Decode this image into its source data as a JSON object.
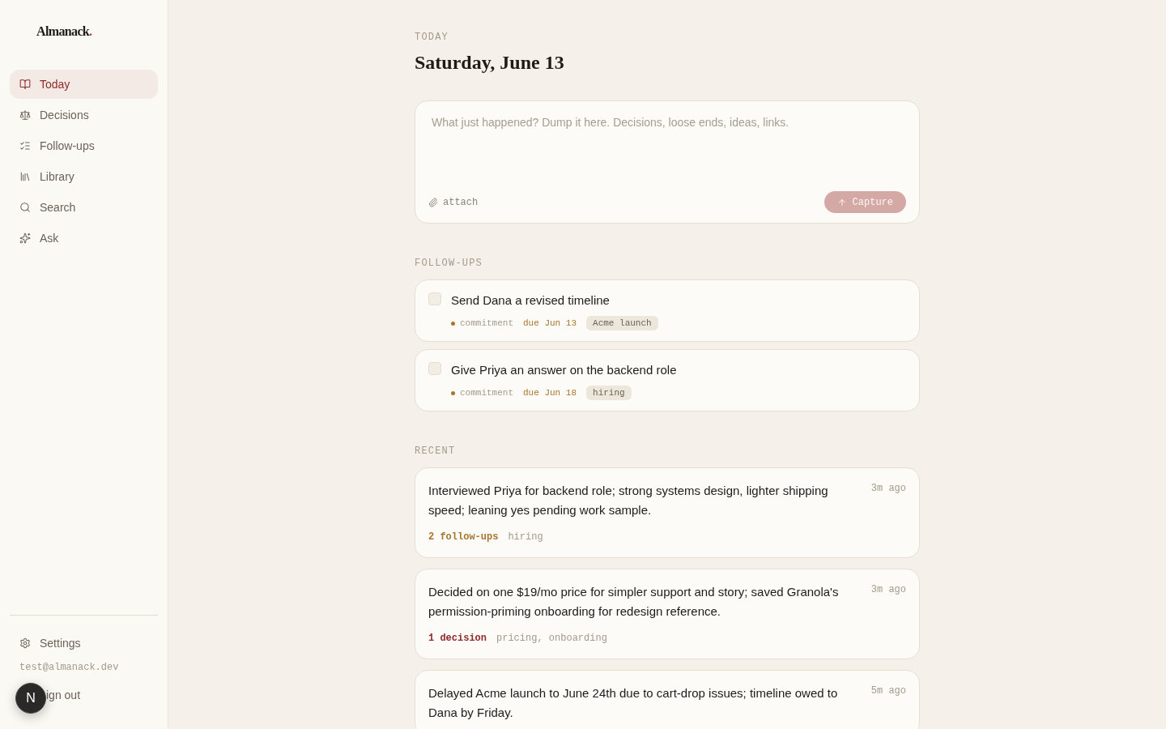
{
  "sidebar": {
    "logo": "Almanack.",
    "nav": [
      {
        "label": "Today",
        "selected": true
      },
      {
        "label": "Decisions",
        "selected": false
      },
      {
        "label": "Follow-ups",
        "selected": false
      },
      {
        "label": "Library",
        "selected": false
      },
      {
        "label": "Search",
        "selected": false
      },
      {
        "label": "Ask",
        "selected": false
      }
    ],
    "settings": "Settings",
    "email": "test@almanack.dev",
    "sign_out": "ign out"
  },
  "dev_badge": "N",
  "header": {
    "eyebrow": "TODAY",
    "title": "Saturday, June 13"
  },
  "capture": {
    "placeholder": "What just happened? Dump it here. Decisions, loose ends, ideas, links.",
    "attach": "attach",
    "submit": {
      "label": "Capture",
      "disabled": true
    }
  },
  "follow_ups": {
    "heading": "FOLLOW-UPS",
    "items": [
      {
        "title": "Send Dana a revised timeline",
        "checked": false,
        "type": "commitment",
        "due": "due Jun 13",
        "tag": "Acme launch"
      },
      {
        "title": "Give Priya an answer on the backend role",
        "checked": false,
        "type": "commitment",
        "due": "due Jun 18",
        "tag": "hiring"
      }
    ]
  },
  "recent": {
    "heading": "RECENT",
    "items": [
      {
        "text": "Interviewed Priya for backend role; strong systems design, lighter shipping speed; leaning yes pending work sample.",
        "time": "3m ago",
        "count": {
          "kind": "follow-ups",
          "label": "2 follow-ups"
        },
        "tags": "hiring"
      },
      {
        "text": "Decided on one $19/mo price for simpler support and story; saved Granola's permission-priming onboarding for redesign reference.",
        "time": "3m ago",
        "count": {
          "kind": "decision",
          "label": "1 decision"
        },
        "tags": "pricing, onboarding"
      },
      {
        "text": "Delayed Acme launch to June 24th due to cart-drop issues; timeline owed to Dana by Friday.",
        "time": "5m ago"
      }
    ]
  }
}
